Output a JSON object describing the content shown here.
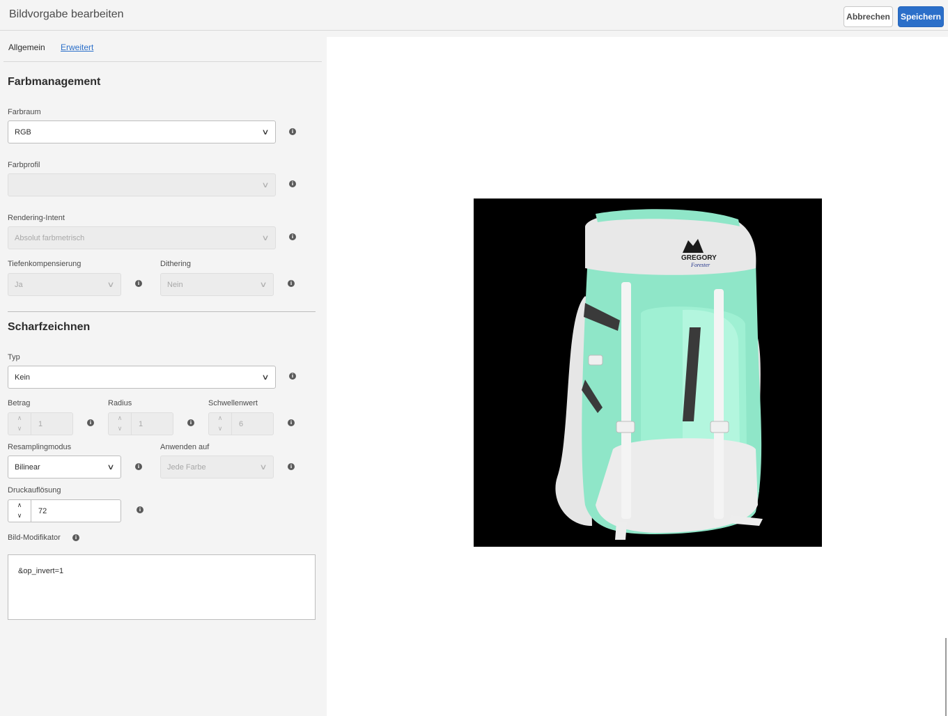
{
  "header": {
    "title": "Bildvorgabe bearbeiten",
    "cancel_label": "Abbrechen",
    "save_label": "Speichern"
  },
  "tabs": [
    {
      "label": "Allgemein",
      "active": false
    },
    {
      "label": "Erweitert",
      "active": true
    }
  ],
  "color_management": {
    "section_title": "Farbmanagement",
    "color_space": {
      "label": "Farbraum",
      "value": "RGB"
    },
    "color_profile": {
      "label": "Farbprofil",
      "value": ""
    },
    "rendering_intent": {
      "label": "Rendering-Intent",
      "value": "Absolut farbmetrisch"
    },
    "depth_compensation": {
      "label": "Tiefenkompensierung",
      "value": "Ja"
    },
    "dithering": {
      "label": "Dithering",
      "value": "Nein"
    }
  },
  "sharpening": {
    "section_title": "Scharfzeichnen",
    "type": {
      "label": "Typ",
      "value": "Kein"
    },
    "amount": {
      "label": "Betrag",
      "value": "1"
    },
    "radius": {
      "label": "Radius",
      "value": "1"
    },
    "threshold": {
      "label": "Schwellenwert",
      "value": "6"
    },
    "resampling_mode": {
      "label": "Resamplingmodus",
      "value": "Bilinear"
    },
    "apply_to": {
      "label": "Anwenden auf",
      "value": "Jede Farbe"
    },
    "print_resolution": {
      "label": "Druckauflösung",
      "value": "72"
    },
    "image_modifier": {
      "label": "Bild-Modifikator",
      "value": "&op_invert=1"
    }
  },
  "preview": {
    "logo_brand": "GREGORY",
    "logo_model": "Forester"
  },
  "colors": {
    "accent": "#2b6fc9",
    "image_background": "#000000",
    "pack_teal": "#8fe6c8"
  }
}
